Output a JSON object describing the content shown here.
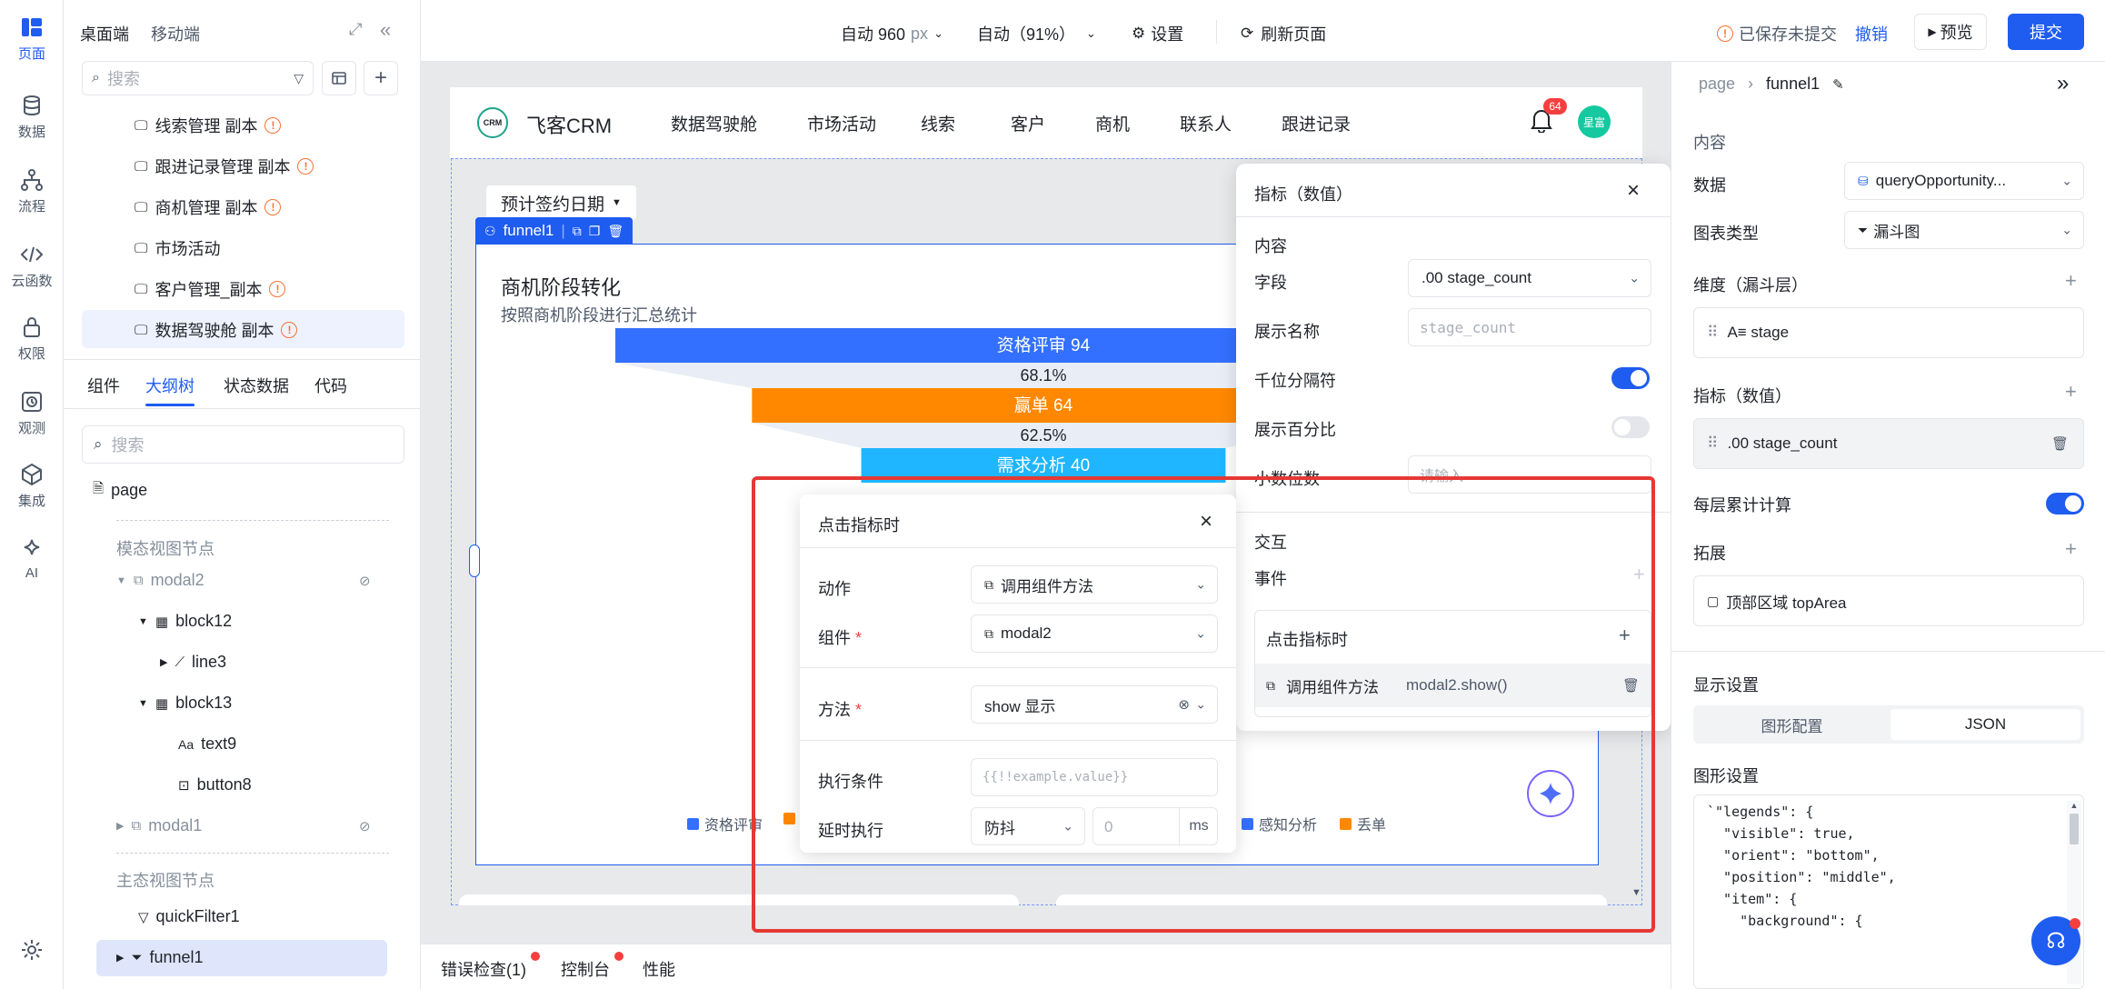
{
  "rail": {
    "items": [
      {
        "label": "页面",
        "icon": "page-icon",
        "active": true
      },
      {
        "label": "数据",
        "icon": "database-icon"
      },
      {
        "label": "流程",
        "icon": "flow-icon"
      },
      {
        "label": "云函数",
        "icon": "code-icon"
      },
      {
        "label": "权限",
        "icon": "lock-icon"
      },
      {
        "label": "观测",
        "icon": "monitor-icon"
      },
      {
        "label": "集成",
        "icon": "cube-icon"
      },
      {
        "label": "AI",
        "icon": "ai-sparkle-icon"
      }
    ]
  },
  "left": {
    "device_tabs": [
      "桌面端",
      "移动端"
    ],
    "search_placeholder": "搜索",
    "pages": [
      "线索管理 副本",
      "跟进记录管理 副本",
      "商机管理 副本",
      "市场活动",
      "客户管理_副本",
      "数据驾驶舱 副本"
    ],
    "panel_tabs": [
      "组件",
      "大纲树",
      "状态数据",
      "代码"
    ],
    "outline_search_placeholder": "搜索",
    "tree": {
      "root": "page",
      "modal_section": "模态视图节点",
      "modal2": "modal2",
      "block12": "block12",
      "line3": "line3",
      "block13": "block13",
      "text9": "text9",
      "button8": "button8",
      "modal1": "modal1",
      "main_section": "主态视图节点",
      "quickFilter1": "quickFilter1",
      "funnel1": "funnel1"
    }
  },
  "topbar": {
    "width_label": "自动 960",
    "width_unit": "px",
    "zoom_label": "自动（91%）",
    "settings_label": "设置",
    "refresh_label": "刷新页面",
    "unsaved_label": "已保存未提交",
    "undo_label": "撤销",
    "preview_label": "预览",
    "submit_label": "提交"
  },
  "app": {
    "logo_text": "CRM",
    "brand": "飞客CRM",
    "nav": [
      "数据驾驶舱",
      "市场活动",
      "线索",
      "客户",
      "商机",
      "联系人",
      "跟进记录"
    ],
    "bell_badge": "64",
    "avatar": "星富",
    "filter_label": "预计签约日期",
    "selected_component": "funnel1",
    "chart_title": "商机阶段转化",
    "chart_subtitle": "按照商机阶段进行汇总统计"
  },
  "chart_data": {
    "type": "funnel",
    "stages": [
      {
        "label": "资格评审 94",
        "name": "资格评审",
        "value": 94,
        "color": "#3370ff"
      },
      {
        "label": "赢单 64",
        "name": "赢单",
        "value": 64,
        "color": "#ff8800"
      },
      {
        "label": "需求分析 40",
        "name": "需求分析",
        "value": 40,
        "color": "#1fb6ff"
      }
    ],
    "conversions": [
      "68.1%",
      "62.5%"
    ],
    "legend": [
      {
        "name": "资格评审",
        "color": "#3370ff"
      },
      {
        "name": "",
        "color": "#ff8800"
      },
      {
        "name": "感知分析",
        "color": "#3370ff"
      },
      {
        "name": "丢单",
        "color": "#ff8800"
      }
    ]
  },
  "metric_panel": {
    "title": "指标（数值）",
    "section_content": "内容",
    "field_label": "字段",
    "field_value": ".00 stage_count",
    "display_name_label": "展示名称",
    "display_name_placeholder": "stage_count",
    "thousands_label": "千位分隔符",
    "percent_label": "展示百分比",
    "decimals_label": "小数位数",
    "decimals_placeholder": "请输入",
    "section_interaction": "交互",
    "events_label": "事件",
    "event_name": "点击指标时",
    "event_action": "调用组件方法",
    "event_code": "modal2.show()"
  },
  "click_dialog": {
    "title": "点击指标时",
    "action_label": "动作",
    "action_value": "调用组件方法",
    "component_label": "组件",
    "component_value": "modal2",
    "method_label": "方法",
    "method_value": "show 显示",
    "condition_label": "执行条件",
    "condition_placeholder": "{{!!example.value}}",
    "delay_label": "延时执行",
    "delay_mode": "防抖",
    "delay_value_placeholder": "0",
    "delay_unit": "ms"
  },
  "right": {
    "breadcrumb_root": "page",
    "breadcrumb_current": "funnel1",
    "section_content": "内容",
    "data_label": "数据",
    "data_value": "queryOpportunity...",
    "chart_type_label": "图表类型",
    "chart_type_value": "漏斗图",
    "dimension_label": "维度（漏斗层）",
    "dimension_value": "A≡ stage",
    "metric_label": "指标（数值）",
    "metric_value": ".00 stage_count",
    "cumulative_label": "每层累计计算",
    "extension_label": "拓展",
    "extension_value": "顶部区域 topArea",
    "display_label": "显示设置",
    "display_tabs": [
      "图形配置",
      "JSON"
    ],
    "graphic_settings_label": "图形设置",
    "json_lines": [
      "`\"legends\": {",
      "  \"visible\": true,",
      "  \"orient\": \"bottom\",",
      "  \"position\": \"middle\",",
      "  \"item\": {",
      "    \"background\": {"
    ]
  },
  "bottom": {
    "tabs": [
      "错误检查(1)",
      "控制台",
      "性能"
    ]
  },
  "colors": {
    "accent": "#1f5cf0",
    "highlight_border": "#e53935",
    "warning": "#f77234"
  }
}
